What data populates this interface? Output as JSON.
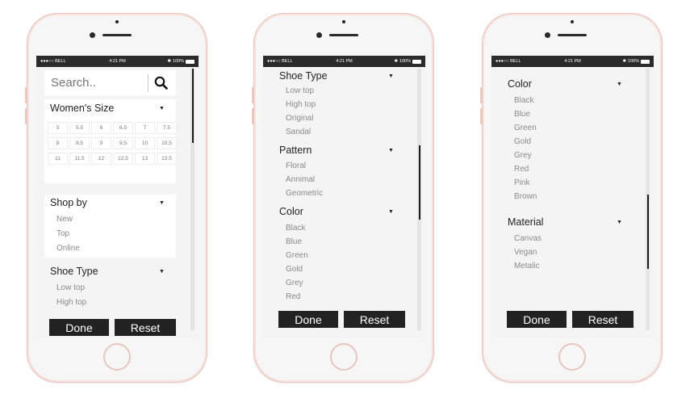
{
  "status": {
    "carrier": "●●●○○ BELL",
    "time": "4:21 PM",
    "battery": "100%"
  },
  "phone1": {
    "search_placeholder": "Search..",
    "womens_size": {
      "title": "Women's Size",
      "sizes": [
        "5",
        "5.5",
        "6",
        "6.5",
        "7",
        "7.5",
        "8",
        "8.5",
        "9",
        "9.5",
        "10",
        "10.5",
        "11",
        "11.5",
        "12",
        "12.5",
        "13",
        "13.5"
      ]
    },
    "shop_by": {
      "title": "Shop by",
      "items": [
        "New",
        "Top",
        "Online"
      ]
    },
    "shoe_type": {
      "title": "Shoe Type",
      "items": [
        "Low top",
        "High top"
      ]
    },
    "done": "Done",
    "reset": "Reset"
  },
  "phone2": {
    "shoe_type": {
      "title": "Shoe Type",
      "items": [
        "Low top",
        "High top",
        "Original",
        "Sandal"
      ]
    },
    "pattern": {
      "title": "Pattern",
      "items": [
        "Floral",
        "Annimal",
        "Geometric"
      ]
    },
    "color": {
      "title": "Color",
      "items": [
        "Black",
        "Blue",
        "Green",
        "Gold",
        "Grey",
        "Red"
      ]
    },
    "done": "Done",
    "reset": "Reset"
  },
  "phone3": {
    "color": {
      "title": "Color",
      "items": [
        "Black",
        "Blue",
        "Green",
        "Gold",
        "Grey",
        "Red",
        "Pink",
        "Brown"
      ]
    },
    "material": {
      "title": "Material",
      "items": [
        "Canvas",
        "Vegan",
        "Metalic"
      ]
    },
    "done": "Done",
    "reset": "Reset"
  },
  "icons": {
    "search": "search-icon",
    "caret": "caret-down-icon",
    "wifi": "wifi-icon",
    "bluetooth": "bluetooth-icon",
    "battery": "battery-icon"
  },
  "colors": {
    "button_bg": "#222222",
    "phone_body": "#f7e2de",
    "screen_bg": "#f4f4f4"
  }
}
